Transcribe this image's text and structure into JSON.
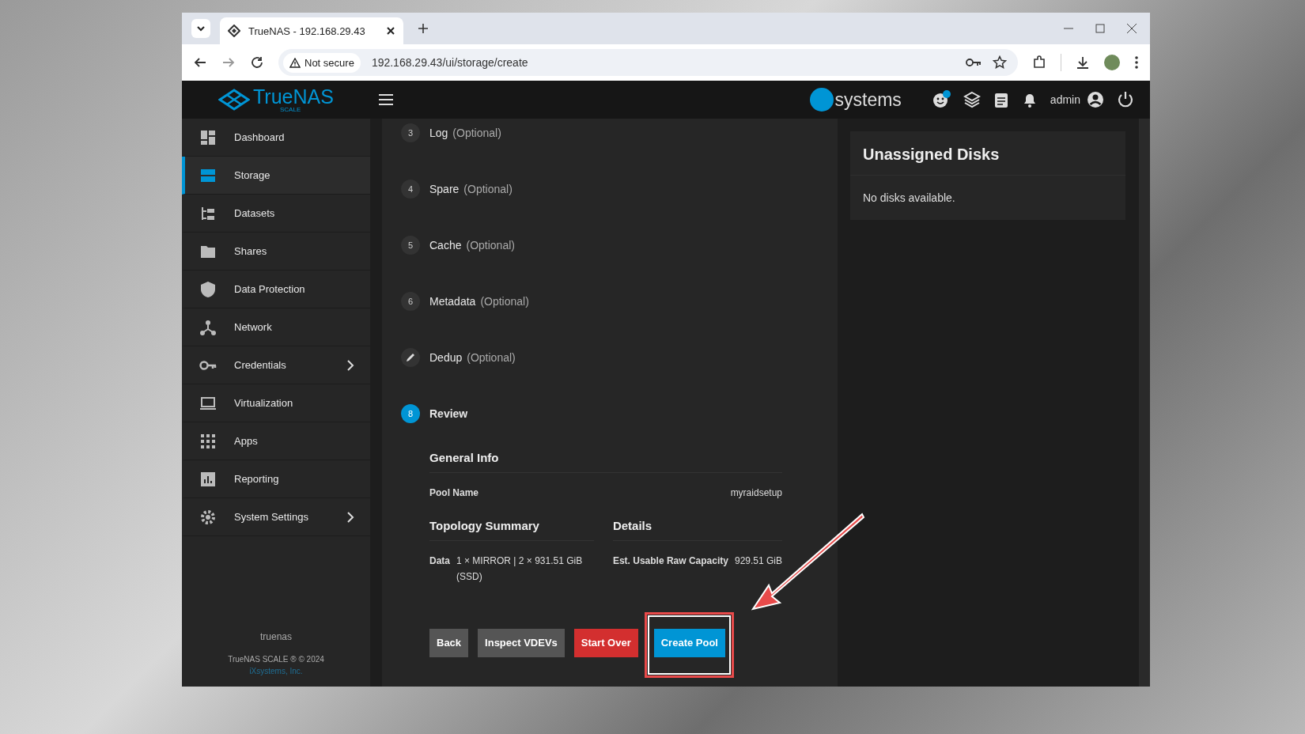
{
  "browser": {
    "tab_title": "TrueNAS - 192.168.29.43",
    "security_label": "Not secure",
    "url": "192.168.29.43/ui/storage/create"
  },
  "header": {
    "logo_text": "TrueNAS",
    "logo_sub": "SCALE",
    "vendor": "systems",
    "user": "admin"
  },
  "sidebar": {
    "items": [
      {
        "label": "Dashboard",
        "selected": false,
        "expandable": false
      },
      {
        "label": "Storage",
        "selected": true,
        "expandable": false
      },
      {
        "label": "Datasets",
        "selected": false,
        "expandable": false
      },
      {
        "label": "Shares",
        "selected": false,
        "expandable": false
      },
      {
        "label": "Data Protection",
        "selected": false,
        "expandable": false
      },
      {
        "label": "Network",
        "selected": false,
        "expandable": false
      },
      {
        "label": "Credentials",
        "selected": false,
        "expandable": true
      },
      {
        "label": "Virtualization",
        "selected": false,
        "expandable": false
      },
      {
        "label": "Apps",
        "selected": false,
        "expandable": false
      },
      {
        "label": "Reporting",
        "selected": false,
        "expandable": false
      },
      {
        "label": "System Settings",
        "selected": false,
        "expandable": true
      }
    ],
    "hostname": "truenas",
    "copyright": "TrueNAS SCALE ® © 2024",
    "company_link": "iXsystems, Inc."
  },
  "steps": [
    {
      "number": "3",
      "label": "Log",
      "suffix": "(Optional)",
      "kind": "number"
    },
    {
      "number": "4",
      "label": "Spare",
      "suffix": "(Optional)",
      "kind": "number"
    },
    {
      "number": "5",
      "label": "Cache",
      "suffix": "(Optional)",
      "kind": "number"
    },
    {
      "number": "6",
      "label": "Metadata",
      "suffix": "(Optional)",
      "kind": "number"
    },
    {
      "label": "Dedup",
      "suffix": "(Optional)",
      "kind": "edited"
    },
    {
      "number": "8",
      "label": "Review",
      "kind": "current"
    }
  ],
  "review": {
    "general_title": "General Info",
    "pool_label": "Pool Name",
    "pool_value": "myraidsetup",
    "topology_title": "Topology Summary",
    "data_label": "Data",
    "data_value": "1 × MIRROR | 2 × 931.51 GiB (SSD)",
    "details_title": "Details",
    "capacity_label": "Est. Usable Raw Capacity",
    "capacity_value": "929.51 GiB"
  },
  "buttons": [
    {
      "label": "Back",
      "kind": "plain"
    },
    {
      "label": "Inspect VDEVs",
      "kind": "plain"
    },
    {
      "label": "Start Over",
      "kind": "danger"
    },
    {
      "label": "Create Pool",
      "kind": "primary"
    }
  ],
  "unassigned": {
    "title": "Unassigned Disks",
    "message": "No disks available."
  }
}
